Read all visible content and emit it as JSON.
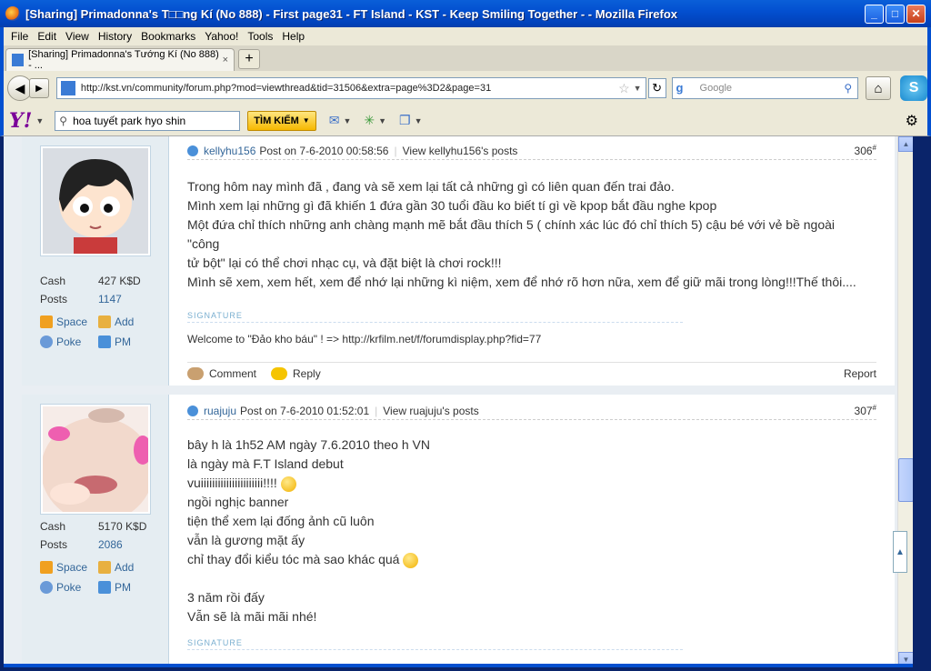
{
  "window": {
    "title": "[Sharing] Primadonna's T□□ng Kí (No 888) - First page31 - FT Island - KST - Keep Smiling Together - - Mozilla Firefox",
    "minimize": "_",
    "maximize": "□",
    "close": "✕"
  },
  "menu": [
    "File",
    "Edit",
    "View",
    "History",
    "Bookmarks",
    "Yahoo!",
    "Tools",
    "Help"
  ],
  "tab": {
    "label": "[Sharing] Primadonna's Tướng Kí (No 888) - ...",
    "close": "×",
    "new_tab": "+"
  },
  "nav": {
    "url": "http://kst.vn/community/forum.php?mod=viewthread&tid=31506&extra=page%3D2&page=31",
    "search_placeholder": "Google"
  },
  "yahoo": {
    "logo": "Y!",
    "search_value": "hoa tuyết park hyo shin",
    "search_button": "TÌM KIẾM"
  },
  "posts": [
    {
      "author": "kellyhu156",
      "posted": "Post on 7-6-2010 00:58:56",
      "view_posts": "View kellyhu156's posts",
      "floor": "306",
      "cash_label": "Cash",
      "cash_value": "427 K$D",
      "posts_label": "Posts",
      "posts_value": "1147",
      "space": "Space",
      "add": "Add",
      "poke": "Poke",
      "pm": "PM",
      "body": [
        "Trong hôm nay mình đã , đang và sẽ xem lại tất cả những gì có liên quan đến trai đảo.",
        "Mình xem lại những gì đã khiến 1 đứa gần 30 tuổi đầu ko biết tí gì về kpop bắt đầu nghe kpop",
        "Một đứa chỉ thích những anh chàng mạnh mẽ bắt đầu thích 5 ( chính xác lúc đó chỉ thích 5) cậu bé với vẻ bề ngoài \"công",
        "tử bột\" lại có thể chơi nhạc cụ, và đặt biệt là chơi rock!!!",
        "Mình sẽ xem, xem hết, xem để nhớ lại những kì niệm, xem để nhớ rõ hơn nữa, xem để giữ mãi trong lòng!!!Thế thôi...."
      ],
      "signature_label": "SIGNATURE",
      "signature": "Welcome to \"Đảo kho báu\" ! => http://krfilm.net/f/forumdisplay.php?fid=77",
      "comment": "Comment",
      "reply": "Reply",
      "report": "Report"
    },
    {
      "author": "ruajuju",
      "posted": "Post on 7-6-2010 01:52:01",
      "view_posts": "View ruajuju's posts",
      "floor": "307",
      "cash_label": "Cash",
      "cash_value": "5170 K$D",
      "posts_label": "Posts",
      "posts_value": "2086",
      "space": "Space",
      "add": "Add",
      "poke": "Poke",
      "pm": "PM",
      "body": [
        "bây h là 1h52 AM ngày 7.6.2010 theo h VN",
        "là ngày mà F.T Island debut",
        "vuiiiiiiiiiiiiiiiiiiiiii!!!!",
        "ngồi nghịc banner",
        "tiện thể xem lại đống ảnh cũ luôn",
        "vẫn là gương mặt ấy",
        "chỉ thay đổi kiểu tóc mà sao khác quá",
        "",
        "3 năm rồi đấy",
        "Vẫn sẽ là mãi mãi nhé!"
      ],
      "signature_label": "SIGNATURE"
    }
  ],
  "colors": {
    "accent": "#336699",
    "titlebar": "#0350d0"
  }
}
